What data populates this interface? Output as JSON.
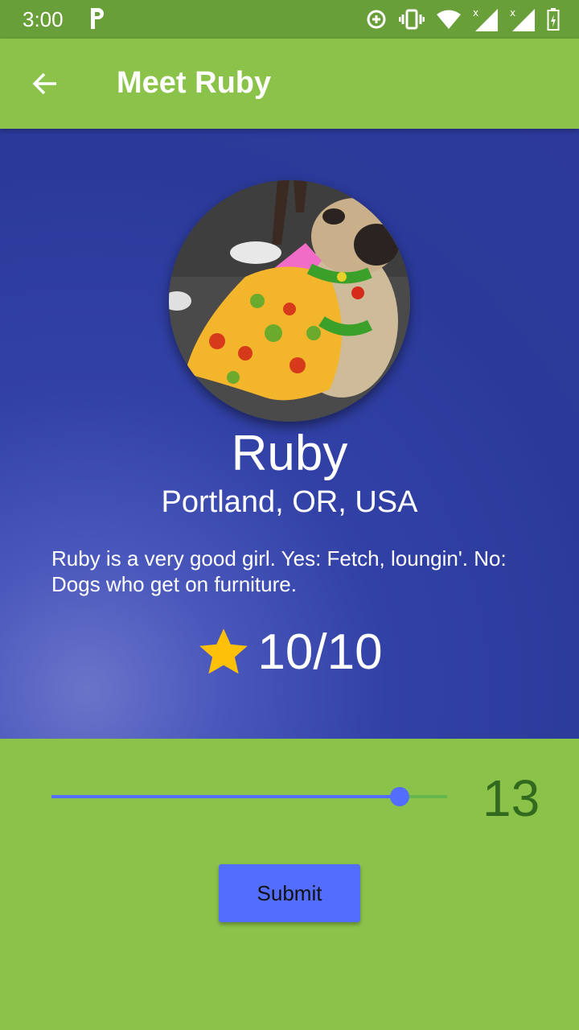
{
  "status_bar": {
    "time": "3:00"
  },
  "app_bar": {
    "title": "Meet Ruby"
  },
  "profile": {
    "name": "Ruby",
    "location": "Portland, OR, USA",
    "description": "Ruby is a very good girl. Yes: Fetch, loungin'. No: Dogs who get on furniture.",
    "rating": "10/10"
  },
  "slider": {
    "value": 13,
    "value_label": "13",
    "fraction": 0.88
  },
  "submit": {
    "label": "Submit"
  },
  "colors": {
    "primary": "#8bc34a",
    "primary_dark": "#689f38",
    "hero": "#2d3a9c",
    "accent": "#536dfe",
    "star": "#ffc107"
  }
}
